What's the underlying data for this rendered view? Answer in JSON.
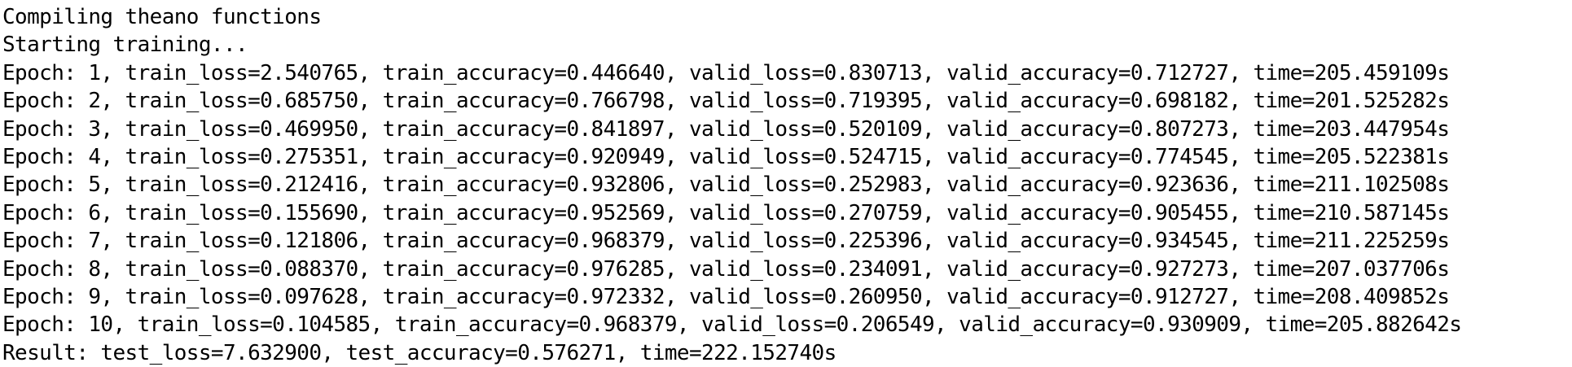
{
  "terminal": {
    "lines": [
      "Compiling theano functions",
      "Starting training...",
      "Epoch: 1, train_loss=2.540765, train_accuracy=0.446640, valid_loss=0.830713, valid_accuracy=0.712727, time=205.459109s",
      "Epoch: 2, train_loss=0.685750, train_accuracy=0.766798, valid_loss=0.719395, valid_accuracy=0.698182, time=201.525282s",
      "Epoch: 3, train_loss=0.469950, train_accuracy=0.841897, valid_loss=0.520109, valid_accuracy=0.807273, time=203.447954s",
      "Epoch: 4, train_loss=0.275351, train_accuracy=0.920949, valid_loss=0.524715, valid_accuracy=0.774545, time=205.522381s",
      "Epoch: 5, train_loss=0.212416, train_accuracy=0.932806, valid_loss=0.252983, valid_accuracy=0.923636, time=211.102508s",
      "Epoch: 6, train_loss=0.155690, train_accuracy=0.952569, valid_loss=0.270759, valid_accuracy=0.905455, time=210.587145s",
      "Epoch: 7, train_loss=0.121806, train_accuracy=0.968379, valid_loss=0.225396, valid_accuracy=0.934545, time=211.225259s",
      "Epoch: 8, train_loss=0.088370, train_accuracy=0.976285, valid_loss=0.234091, valid_accuracy=0.927273, time=207.037706s",
      "Epoch: 9, train_loss=0.097628, train_accuracy=0.972332, valid_loss=0.260950, valid_accuracy=0.912727, time=208.409852s",
      "Epoch: 10, train_loss=0.104585, train_accuracy=0.968379, valid_loss=0.206549, valid_accuracy=0.930909, time=205.882642s",
      "Result: test_loss=7.632900, test_accuracy=0.576271, time=222.152740s"
    ]
  }
}
